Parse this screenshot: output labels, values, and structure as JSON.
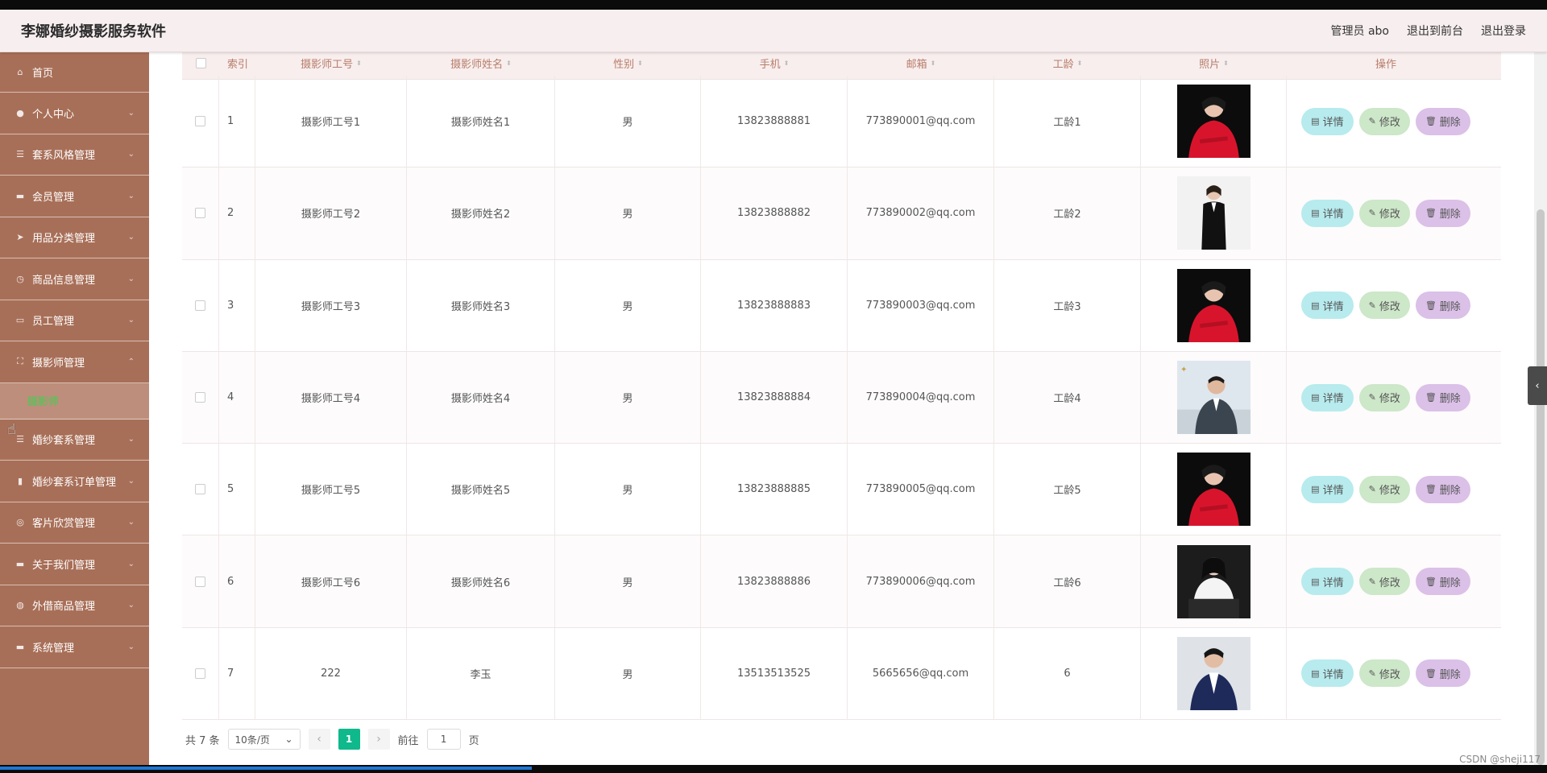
{
  "header": {
    "app_title": "李娜婚纱摄影服务软件",
    "user_label": "管理员 abo",
    "to_front": "退出到前台",
    "logout": "退出登录"
  },
  "sidebar": {
    "items": [
      {
        "label": "首页",
        "icon": "home-icon"
      },
      {
        "label": "个人中心",
        "icon": "user-icon"
      },
      {
        "label": "套系风格管理",
        "icon": "list-icon"
      },
      {
        "label": "会员管理",
        "icon": "chat-icon"
      },
      {
        "label": "用品分类管理",
        "icon": "send-icon"
      },
      {
        "label": "商品信息管理",
        "icon": "clock-icon"
      },
      {
        "label": "员工管理",
        "icon": "card-icon"
      },
      {
        "label": "摄影师管理",
        "icon": "frame-icon"
      },
      {
        "label": "婚纱套系管理",
        "icon": "list-icon"
      },
      {
        "label": "婚纱套系订单管理",
        "icon": "chart-icon"
      },
      {
        "label": "客片欣赏管理",
        "icon": "compass-icon"
      },
      {
        "label": "关于我们管理",
        "icon": "monitor-icon"
      },
      {
        "label": "外借商品管理",
        "icon": "globe-icon"
      },
      {
        "label": "系统管理",
        "icon": "monitor-icon"
      }
    ],
    "active_sub": "摄影师"
  },
  "table": {
    "headers": [
      "索引",
      "摄影师工号",
      "摄影师姓名",
      "性别",
      "手机",
      "邮箱",
      "工龄",
      "照片",
      "操作"
    ],
    "rows": [
      {
        "idx": "1",
        "no": "摄影师工号1",
        "name": "摄影师姓名1",
        "sex": "男",
        "phone": "13823888881",
        "mail": "773890001@qq.com",
        "age": "工龄1"
      },
      {
        "idx": "2",
        "no": "摄影师工号2",
        "name": "摄影师姓名2",
        "sex": "男",
        "phone": "13823888882",
        "mail": "773890002@qq.com",
        "age": "工龄2"
      },
      {
        "idx": "3",
        "no": "摄影师工号3",
        "name": "摄影师姓名3",
        "sex": "男",
        "phone": "13823888883",
        "mail": "773890003@qq.com",
        "age": "工龄3"
      },
      {
        "idx": "4",
        "no": "摄影师工号4",
        "name": "摄影师姓名4",
        "sex": "男",
        "phone": "13823888884",
        "mail": "773890004@qq.com",
        "age": "工龄4"
      },
      {
        "idx": "5",
        "no": "摄影师工号5",
        "name": "摄影师姓名5",
        "sex": "男",
        "phone": "13823888885",
        "mail": "773890005@qq.com",
        "age": "工龄5"
      },
      {
        "idx": "6",
        "no": "摄影师工号6",
        "name": "摄影师姓名6",
        "sex": "男",
        "phone": "13823888886",
        "mail": "773890006@qq.com",
        "age": "工龄6"
      },
      {
        "idx": "7",
        "no": "222",
        "name": "李玉",
        "sex": "男",
        "phone": "13513513525",
        "mail": "5665656@qq.com",
        "age": "6"
      }
    ],
    "actions": {
      "detail": "详情",
      "edit": "修改",
      "delete": "删除"
    }
  },
  "pager": {
    "total": "共 7 条",
    "page_size": "10条/页",
    "current": "1",
    "goto_prefix": "前往",
    "goto_value": "1",
    "goto_suffix": "页"
  },
  "watermark": "CSDN @sheji117",
  "colors": {
    "sidebar": "#a86f58",
    "active_sub": "#3cd24f",
    "pager_active": "#0fb98b"
  }
}
